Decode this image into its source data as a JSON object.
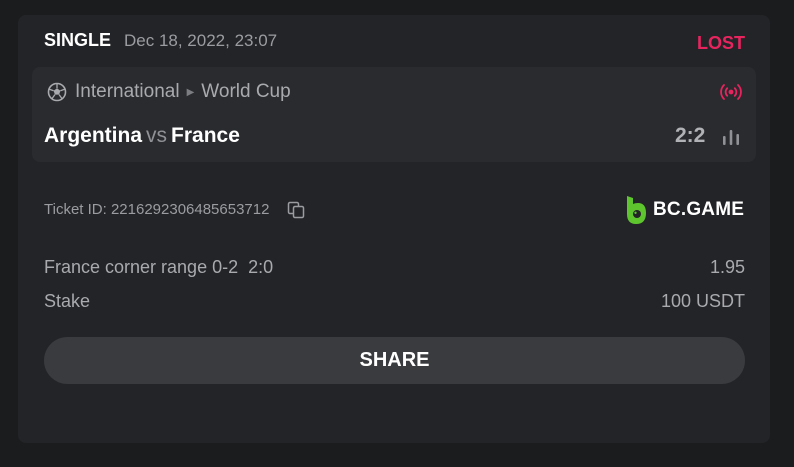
{
  "bet": {
    "type": "SINGLE",
    "date": "Dec 18, 2022, 23:07",
    "status": "LOST",
    "status_color": "#e8245f"
  },
  "match": {
    "sport_icon": "soccer-ball-icon",
    "category": "International",
    "tournament": "World Cup",
    "live_icon": "broadcast-icon",
    "home_team": "Argentina",
    "vs": "vs",
    "away_team": "France",
    "score": "2:2",
    "stats_icon": "bar-chart-icon"
  },
  "ticket": {
    "label": "Ticket ID: 2216292306485653712",
    "copy_icon": "copy-icon"
  },
  "brand": {
    "name": "BC.GAME",
    "logo_color": "#5ec52e"
  },
  "selection": {
    "market": "France corner range 0-2",
    "outcome": "2:0",
    "odds": "1.95"
  },
  "stake": {
    "label": "Stake",
    "value": "100 USDT"
  },
  "share_label": "SHARE"
}
